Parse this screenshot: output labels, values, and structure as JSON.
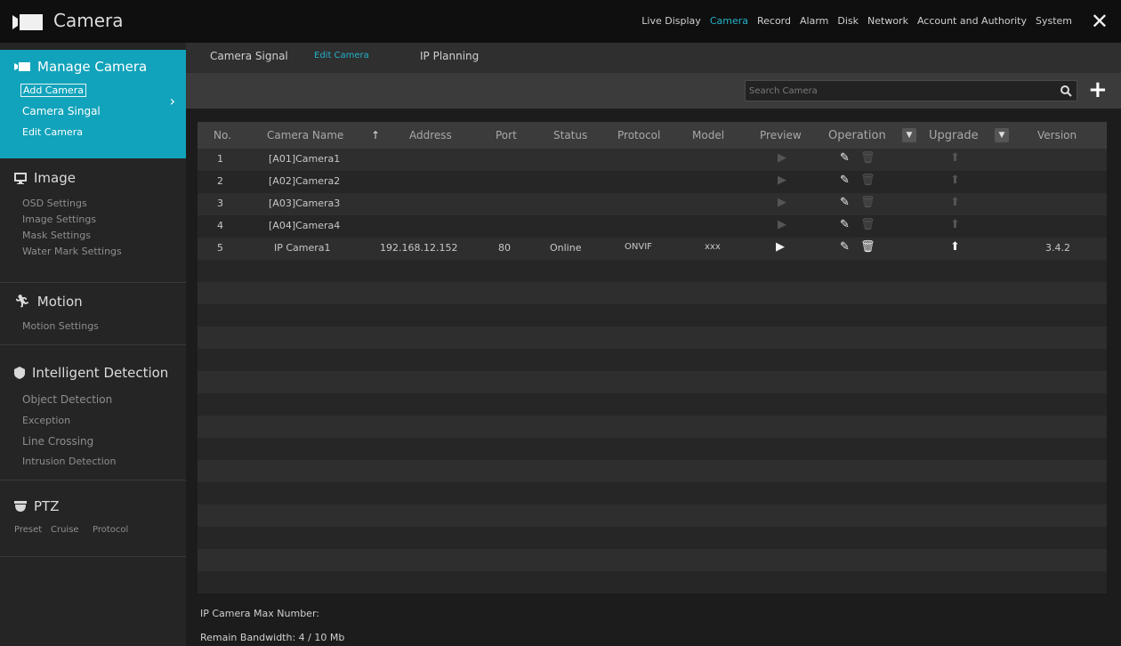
{
  "app": {
    "title": "Camera"
  },
  "topnav": [
    {
      "label": "Live Display",
      "active": false
    },
    {
      "label": "Camera",
      "active": true
    },
    {
      "label": "Record",
      "active": false
    },
    {
      "label": "Alarm",
      "active": false
    },
    {
      "label": "Disk",
      "active": false
    },
    {
      "label": "Network",
      "active": false
    },
    {
      "label": "Account and Authority",
      "active": false
    },
    {
      "label": "System",
      "active": false
    }
  ],
  "sidebar": {
    "manage": {
      "title": "Manage Camera",
      "items": [
        "Add Camera",
        "Camera Singal",
        "Edit Camera"
      ]
    },
    "image": {
      "title": "Image",
      "items": [
        "OSD Settings",
        "Image Settings",
        "Mask Settings",
        "Water Mark Settings"
      ]
    },
    "motion": {
      "title": "Motion",
      "items": [
        "Motion Settings"
      ]
    },
    "intelligent": {
      "title": "Intelligent Detection",
      "items": [
        "Object Detection",
        "Exception",
        "Line Crossing",
        "Intrusion Detection"
      ]
    },
    "ptz": {
      "title": "PTZ",
      "items": [
        "Preset",
        "Cruise",
        "Protocol"
      ]
    }
  },
  "subtabs": [
    {
      "label": "Camera Signal",
      "active": false
    },
    {
      "label": "Edit Camera",
      "active": true
    },
    {
      "label": "IP Planning",
      "active": false
    }
  ],
  "search": {
    "placeholder": "Search Camera"
  },
  "table": {
    "headers": {
      "no": "No.",
      "name": "Camera Name",
      "address": "Address",
      "port": "Port",
      "status": "Status",
      "protocol": "Protocol",
      "model": "Model",
      "preview": "Preview",
      "operation": "Operation",
      "upgrade": "Upgrade",
      "version": "Version"
    },
    "rows": [
      {
        "no": "1",
        "name": "[A01]Camera1",
        "address": "",
        "port": "",
        "status": "",
        "protocol": "",
        "model": "",
        "version": ""
      },
      {
        "no": "2",
        "name": "[A02]Camera2",
        "address": "",
        "port": "",
        "status": "",
        "protocol": "",
        "model": "",
        "version": ""
      },
      {
        "no": "3",
        "name": "[A03]Camera3",
        "address": "",
        "port": "",
        "status": "",
        "protocol": "",
        "model": "",
        "version": ""
      },
      {
        "no": "4",
        "name": "[A04]Camera4",
        "address": "",
        "port": "",
        "status": "",
        "protocol": "",
        "model": "",
        "version": ""
      },
      {
        "no": "5",
        "name": "IP Camera1",
        "address": "192.168.12.152",
        "port": "80",
        "status": "Online",
        "protocol": "ONVIF",
        "model": "xxx",
        "version": "3.4.2"
      }
    ]
  },
  "footer": {
    "max_number": "IP Camera Max Number:",
    "bandwidth": "Remain Bandwidth:  4 / 10 Mb"
  },
  "colors": {
    "accent": "#11a3bb",
    "active_text": "#23b2c8",
    "background": "#1f1f1f"
  }
}
